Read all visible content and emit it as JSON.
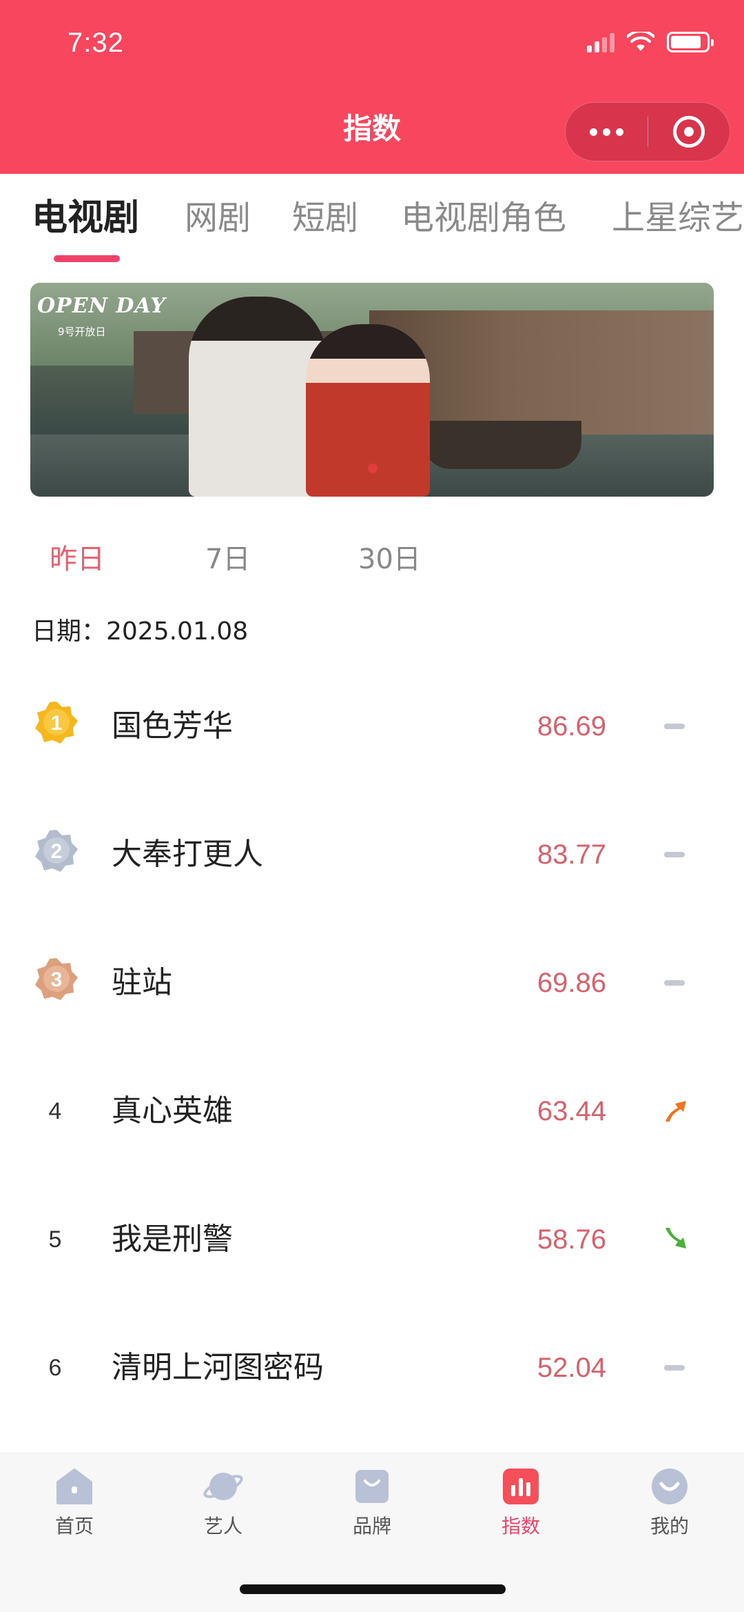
{
  "status_bar": {
    "time": "7:32"
  },
  "header": {
    "title": "指数"
  },
  "tabs": [
    {
      "label": "电视剧",
      "active": true
    },
    {
      "label": "网剧"
    },
    {
      "label": "短剧"
    },
    {
      "label": "电视剧角色"
    },
    {
      "label": "上星综艺"
    }
  ],
  "banner": {
    "logo_text": "OPEN DAY",
    "logo_sub": "9号开放日"
  },
  "periods": [
    {
      "label": "昨日",
      "active": true
    },
    {
      "label": "7日"
    },
    {
      "label": "30日"
    }
  ],
  "date_text": "日期：2025.01.08",
  "rankings": [
    {
      "rank": "1",
      "title": "国色芳华",
      "score": "86.69",
      "trend": "flat"
    },
    {
      "rank": "2",
      "title": "大奉打更人",
      "score": "83.77",
      "trend": "flat"
    },
    {
      "rank": "3",
      "title": "驻站",
      "score": "69.86",
      "trend": "flat"
    },
    {
      "rank": "4",
      "title": "真心英雄",
      "score": "63.44",
      "trend": "up"
    },
    {
      "rank": "5",
      "title": "我是刑警",
      "score": "58.76",
      "trend": "down"
    },
    {
      "rank": "6",
      "title": "清明上河图密码",
      "score": "52.04",
      "trend": "flat"
    }
  ],
  "bottom_nav": [
    {
      "label": "首页",
      "icon": "home-icon"
    },
    {
      "label": "艺人",
      "icon": "planet-icon"
    },
    {
      "label": "品牌",
      "icon": "bag-icon"
    },
    {
      "label": "指数",
      "icon": "chart-icon",
      "active": true
    },
    {
      "label": "我的",
      "icon": "face-icon"
    }
  ],
  "colors": {
    "brand": "#f8465f",
    "accent": "#f0436a",
    "score": "#d8606b",
    "gold": "#f5b61e",
    "silver": "#b3bccd",
    "bronze": "#dca07f",
    "up": "#f2731f",
    "down": "#4caf3a"
  }
}
